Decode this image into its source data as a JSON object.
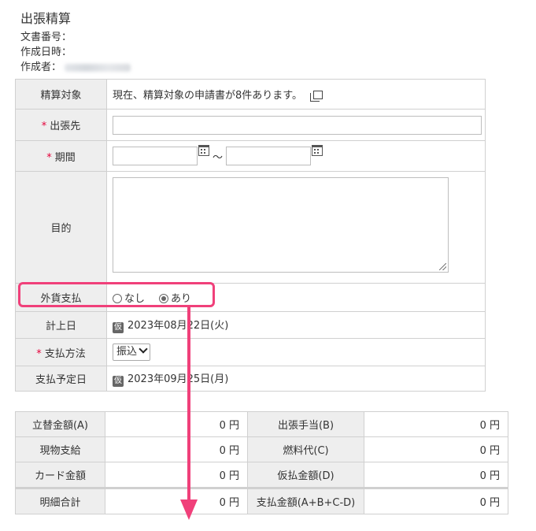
{
  "page": {
    "title": "出張精算",
    "doc_number_label": "文書番号：",
    "created_at_label": "作成日時：",
    "author_label": "作成者："
  },
  "form": {
    "settlement_target": {
      "label": "精算対象",
      "text": "現在、精算対象の申請書が8件あります。"
    },
    "destination": {
      "required_mark": "*",
      "label": "出張先",
      "value": ""
    },
    "period": {
      "required_mark": "*",
      "label": "期間",
      "start": "",
      "end": "",
      "separator": "～"
    },
    "purpose": {
      "label": "目的",
      "value": ""
    },
    "foreign_currency": {
      "label": "外貨支払",
      "options": [
        "なし",
        "あり"
      ],
      "selected": "あり"
    },
    "posting_date": {
      "label": "計上日",
      "badge": "仮",
      "value": "2023年08月22日(火)"
    },
    "payment_method": {
      "required_mark": "*",
      "label": "支払方法",
      "value": "振込"
    },
    "scheduled_payment_date": {
      "label": "支払予定日",
      "badge": "仮",
      "value": "2023年09月25日(月)"
    }
  },
  "amounts": {
    "advance": {
      "label": "立替金額(A)",
      "value": "0 円"
    },
    "trip_allowance": {
      "label": "出張手当(B)",
      "value": "0 円"
    },
    "in_kind": {
      "label": "現物支給",
      "value": "0 円"
    },
    "fuel": {
      "label": "燃料代(C)",
      "value": "0 円"
    },
    "card": {
      "label": "カード金額",
      "value": "0 円"
    },
    "provisional": {
      "label": "仮払金額(D)",
      "value": "0 円"
    },
    "detail_total": {
      "label": "明細合計",
      "value": "0 円"
    },
    "payment_total": {
      "label": "支払金額(A+B+C-D)",
      "value": "0 円"
    }
  },
  "annotation": {
    "color": "#f0407a"
  },
  "icons": {
    "copy": "copy-icon",
    "calendar": "calendar-icon",
    "provisional_badge": "provisional-badge-icon",
    "chevron": "chevron-down-icon"
  }
}
